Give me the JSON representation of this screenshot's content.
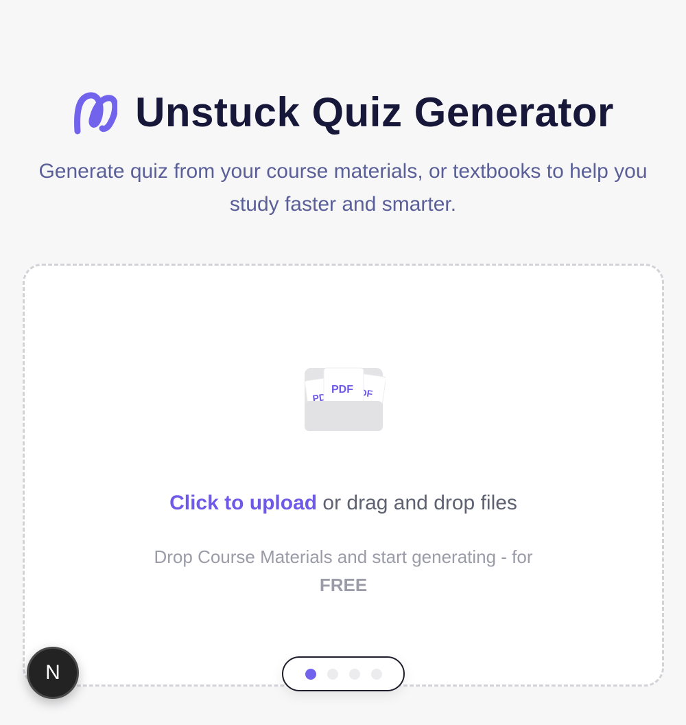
{
  "header": {
    "title": "Unstuck Quiz Generator",
    "subtitle": "Generate quiz from your course materials, or textbooks to help you study faster and smarter."
  },
  "upload": {
    "link_text": "Click to upload",
    "rest_text": " or drag and drop files",
    "hint_text": "Drop Course Materials and start generating - for",
    "hint_emphasis": "FREE",
    "file_labels": [
      "PDF",
      "PDF",
      "PDF"
    ]
  },
  "pager": {
    "count": 4,
    "active_index": 0
  },
  "badge": {
    "letter": "N"
  },
  "colors": {
    "accent": "#6f5ae8",
    "title": "#17173a",
    "subtitle": "#5a5f97",
    "hint": "#9b9ca8",
    "background": "#f7f7f8"
  },
  "icons": {
    "logo": "unstuck-logo-icon",
    "files": "pdf-files-icon"
  }
}
